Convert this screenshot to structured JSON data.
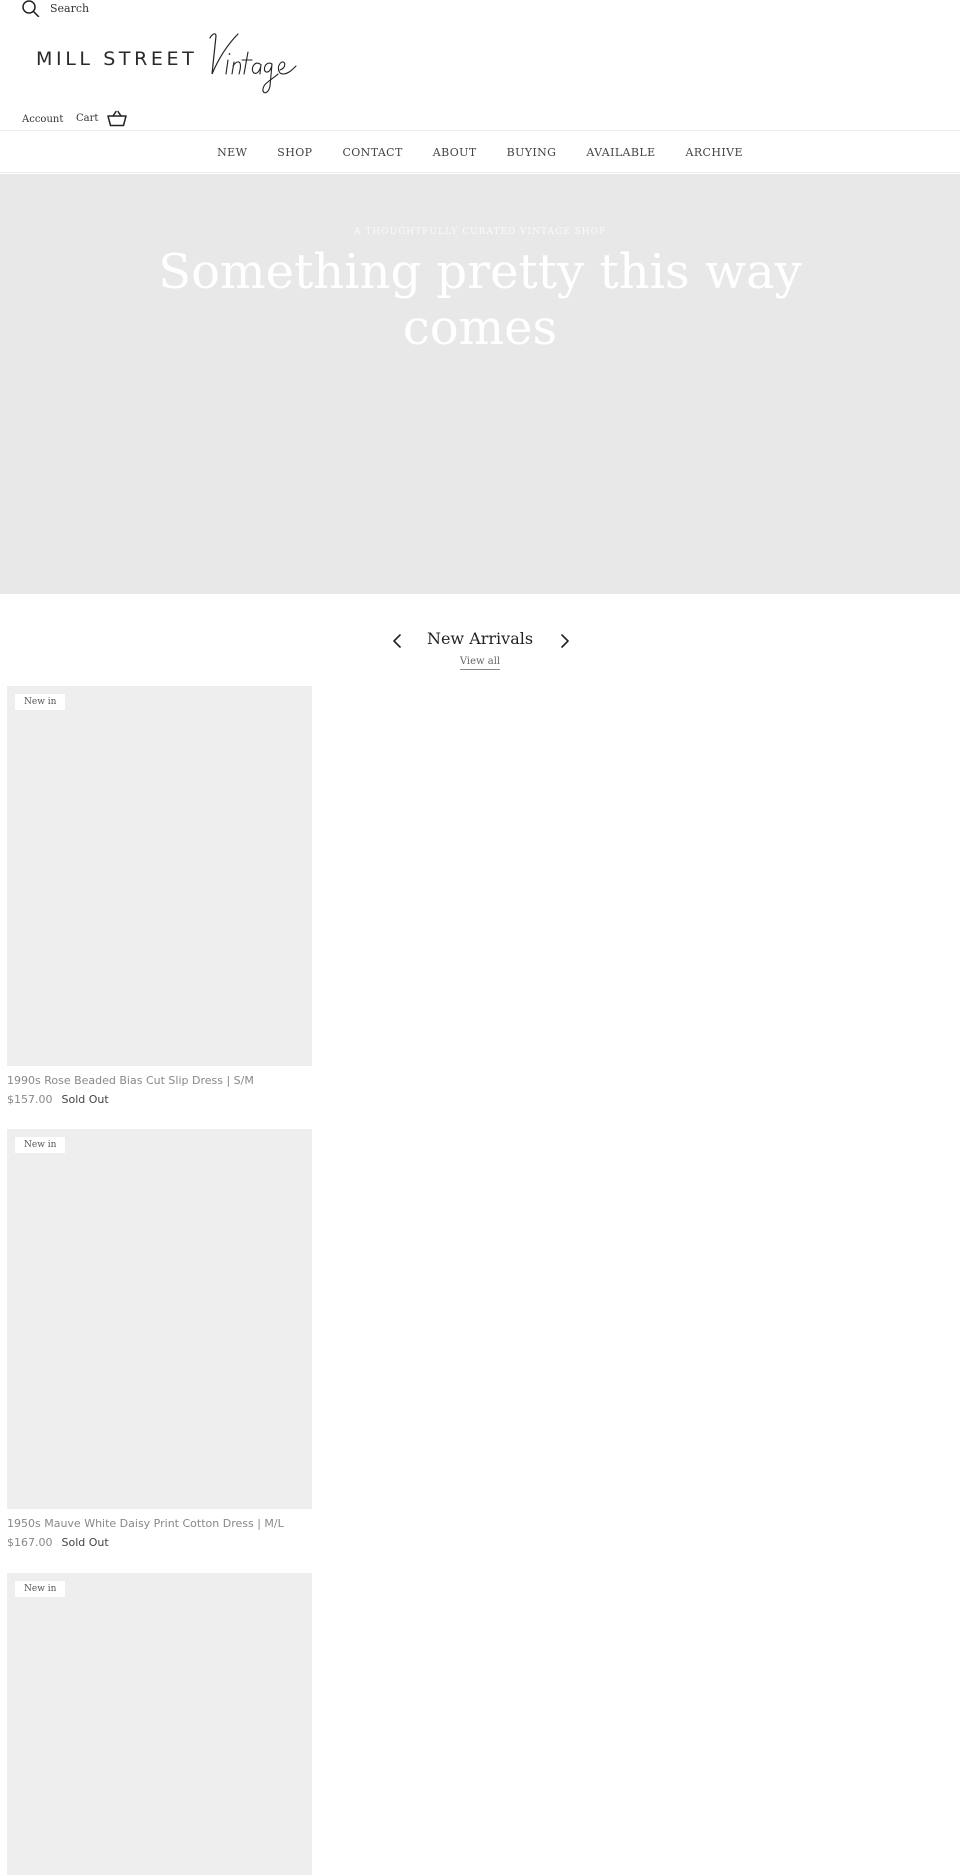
{
  "header": {
    "search_label": "Search",
    "logo_text": "MILL STREET",
    "logo_script": "Vintage",
    "account_label": "Account",
    "cart_label": "Cart"
  },
  "nav": {
    "items": [
      "NEW",
      "SHOP",
      "CONTACT",
      "ABOUT",
      "BUYING",
      "AVAILABLE",
      "ARCHIVE"
    ]
  },
  "hero": {
    "eyebrow": "A THOUGHTFULLY CURATED VINTAGE SHOP",
    "title": "Something pretty this way comes"
  },
  "new_arrivals": {
    "title": "New Arrivals",
    "view_all": "View all",
    "products": [
      {
        "badge": "New in",
        "name": "1990s Rose Beaded Bias Cut Slip Dress | S/M",
        "price": "$157.00",
        "status": "Sold Out"
      },
      {
        "badge": "New in",
        "name": "1950s Mauve White Daisy Print Cotton Dress | M/L",
        "price": "$167.00",
        "status": "Sold Out"
      },
      {
        "badge": "New in"
      }
    ]
  },
  "colors": {
    "hero_bg": "#e8e8e8",
    "product_bg": "#eeeeee",
    "text": "#222222",
    "muted": "#888888"
  },
  "icons": [
    "search-icon",
    "basket-icon",
    "chevron-left-icon",
    "chevron-right-icon"
  ]
}
